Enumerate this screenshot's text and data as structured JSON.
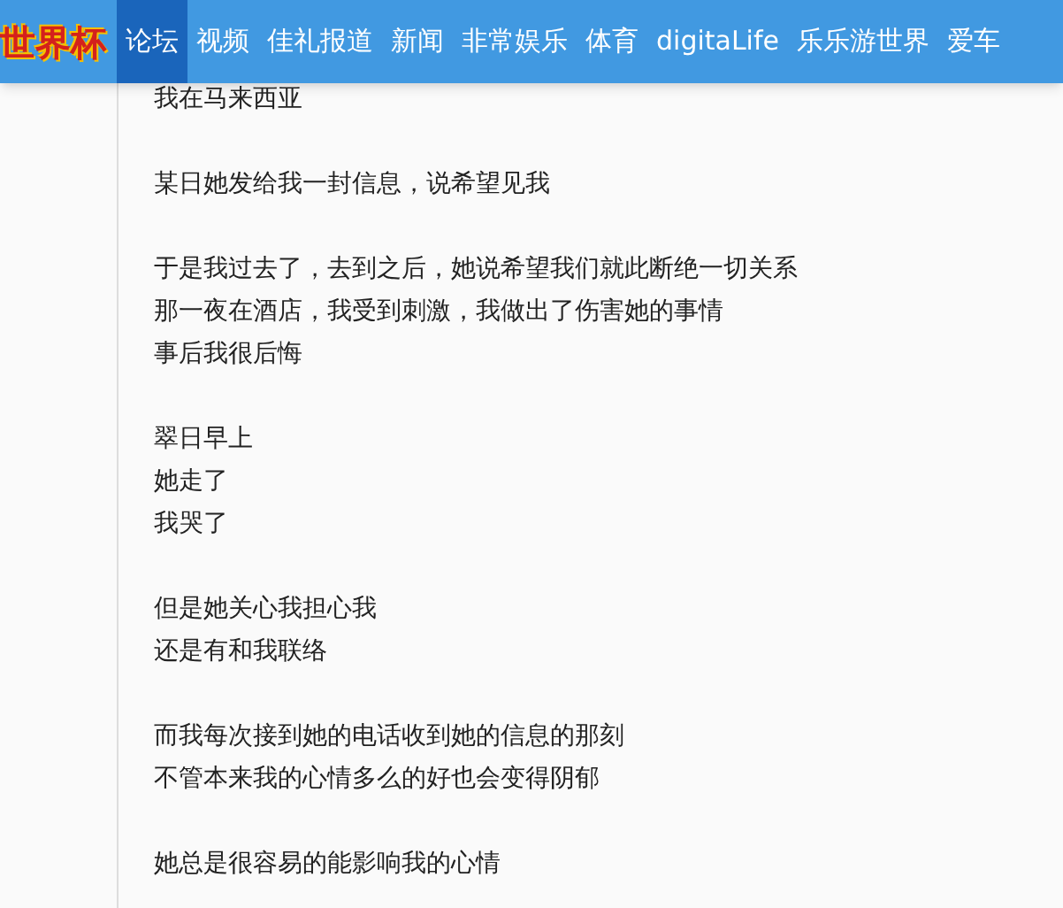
{
  "logo": "世界杯",
  "nav": [
    {
      "label": "论坛",
      "selected": true
    },
    {
      "label": "视频",
      "selected": false
    },
    {
      "label": "佳礼报道",
      "selected": false
    },
    {
      "label": "新闻",
      "selected": false
    },
    {
      "label": "非常娱乐",
      "selected": false
    },
    {
      "label": "体育",
      "selected": false
    },
    {
      "label": "digitaLife",
      "selected": false
    },
    {
      "label": "乐乐游世界",
      "selected": false
    },
    {
      "label": "爱车",
      "selected": false
    }
  ],
  "post": {
    "paragraphs": [
      [
        "我在马来西亚"
      ],
      [
        "某日她发给我一封信息，说希望见我"
      ],
      [
        "于是我过去了，去到之后，她说希望我们就此断绝一切关系",
        "那一夜在酒店，我受到刺激，我做出了伤害她的事情",
        "事后我很后悔"
      ],
      [
        "翠日早上",
        "她走了",
        "我哭了"
      ],
      [
        "但是她关心我担心我",
        "还是有和我联络"
      ],
      [
        "而我每次接到她的电话收到她的信息的那刻",
        "不管本来我的心情多么的好也会变得阴郁"
      ],
      [
        "她总是很容易的能影响我的心情"
      ]
    ]
  }
}
